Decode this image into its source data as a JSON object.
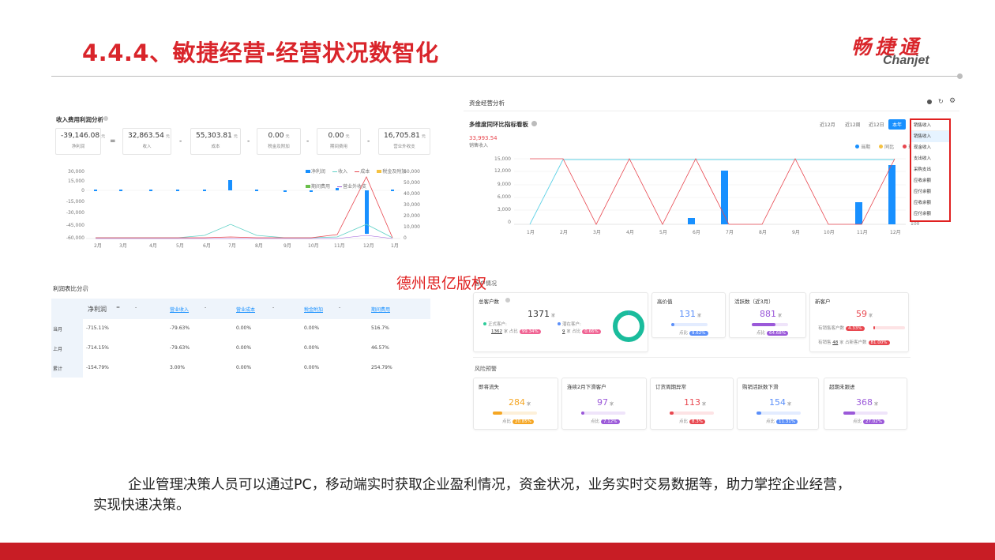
{
  "slide": {
    "title": "4.4.4、敏捷经营-经营状况数智化",
    "logo_cn": "畅捷通",
    "logo_en": "Chanjet",
    "watermark": "德州思亿版权",
    "description": "企业管理决策人员可以通过PC，移动端实时获取企业盈利情况，资金状况，业务实时交易数据等，助力掌控企业经营，实现快速决策。"
  },
  "panel1": {
    "title": "收入费用利润分析",
    "kpis": [
      {
        "value": "-39,146.08",
        "unit": "元",
        "label": "净利润"
      },
      {
        "value": "32,863.54",
        "unit": "元",
        "label": "收入"
      },
      {
        "value": "55,303.81",
        "unit": "元",
        "label": "成本"
      },
      {
        "value": "0.00",
        "unit": "元",
        "label": "税金及附加"
      },
      {
        "value": "0.00",
        "unit": "元",
        "label": "期间费用"
      },
      {
        "value": "16,705.81",
        "unit": "元",
        "label": "营业外收支"
      }
    ],
    "operators": [
      "=",
      "-",
      "-",
      "-",
      "-"
    ],
    "legend": [
      "净利润",
      "收入",
      "成本",
      "税金及附加",
      "期间费用",
      "营业外收支"
    ],
    "y_left_ticks": [
      "30,000",
      "15,000",
      "0",
      "-15,000",
      "-30,000",
      "-45,000",
      "-60,000"
    ],
    "y_right_ticks": [
      "60,000",
      "50,000",
      "40,000",
      "30,000",
      "20,000",
      "10,000",
      "0"
    ],
    "months": [
      "2月",
      "3月",
      "4月",
      "5月",
      "6月",
      "7月",
      "8月",
      "9月",
      "10月",
      "11月",
      "12月",
      "1月"
    ]
  },
  "panel2": {
    "header": "资金经营分析",
    "title": "多维度同环比指标看板",
    "tabs": [
      "近12月",
      "近12周",
      "近12日",
      "本年"
    ],
    "dropdown_selected": "销售收入",
    "dropdown_items": [
      "销售收入",
      "现金收入",
      "支出收入",
      "采购支出",
      "应收余额",
      "应付余额",
      "应收余额",
      "应付余额"
    ],
    "kpi_value": "33,993.54",
    "kpi_label": "销售收入",
    "legend": [
      "当期",
      "同比",
      "环比"
    ],
    "y_ticks": [
      "15,000",
      "12,000",
      "9,000",
      "6,000",
      "3,000",
      "0"
    ],
    "y_right_last": "100",
    "months": [
      "1月",
      "2月",
      "3月",
      "4月",
      "5月",
      "6月",
      "7月",
      "8月",
      "9月",
      "10月",
      "11月",
      "12月"
    ]
  },
  "panel3": {
    "title": "利润表比分析",
    "headers": [
      "净利润",
      "=",
      "-",
      "营业收入",
      "-",
      "营业成本",
      "-",
      "税金附加",
      "-",
      "期间费用"
    ],
    "rows": [
      {
        "label": "当月",
        "cells": [
          "-715.11%",
          "",
          "",
          "-79.63%",
          "",
          "0.00%",
          "",
          "0.00%",
          "",
          "516.7%"
        ]
      },
      {
        "label": "上月",
        "cells": [
          "-714.15%",
          "",
          "",
          "-79.63%",
          "",
          "0.00%",
          "",
          "0.00%",
          "",
          "46.57%"
        ]
      },
      {
        "label": "累计",
        "cells": [
          "-154.79%",
          "",
          "",
          "3.00%",
          "",
          "0.00%",
          "",
          "0.00%",
          "",
          "254.79%"
        ]
      }
    ]
  },
  "panel4": {
    "section_top": "客户情况",
    "total": {
      "title": "总客户数",
      "value": "1371",
      "unit": "家",
      "formal_label": "正式客户:",
      "formal_count": "1362",
      "formal_pct": "99.34%",
      "potential_label": "潜在客户:",
      "potential_count": "9",
      "potential_pct": "0.66%",
      "share_label": "占比"
    },
    "top_cards": [
      {
        "title": "高价值",
        "value": "131",
        "unit": "家",
        "pct": "9.62%",
        "color": "#5b8ff9",
        "fill": 0.0962
      },
      {
        "title": "活跃数（近3月）",
        "value": "881",
        "unit": "家",
        "pct": "64.68%",
        "color": "#9b59d9",
        "fill": 0.6468
      },
      {
        "title": "新客户",
        "value": "59",
        "unit": "家",
        "pct": "4.33%",
        "color": "#e8474f",
        "fill": 0.0433
      }
    ],
    "new_extra": {
      "label1": "有销售客户数",
      "label2": "有销售",
      "count": "48",
      "unit": "家",
      "label3": "占新客户数",
      "pct": "81.00%"
    },
    "section_bottom": "风险预警",
    "risk_cards": [
      {
        "title": "即将流失",
        "value": "284",
        "unit": "家",
        "pct": "20.85%",
        "color": "#f5a623",
        "fill": 0.2085
      },
      {
        "title": "连续2月下滑客户",
        "value": "97",
        "unit": "家",
        "pct": "7.12%",
        "color": "#9b59d9",
        "fill": 0.0712
      },
      {
        "title": "订货周期异常",
        "value": "113",
        "unit": "家",
        "pct": "8.3%",
        "color": "#e8474f",
        "fill": 0.083
      },
      {
        "title": "购销活跃数下滑",
        "value": "154",
        "unit": "家",
        "pct": "11.31%",
        "color": "#5b8ff9",
        "fill": 0.1131
      },
      {
        "title": "超期未跟进",
        "value": "368",
        "unit": "家",
        "pct": "27.02%",
        "color": "#9b59d9",
        "fill": 0.2702
      }
    ]
  }
}
